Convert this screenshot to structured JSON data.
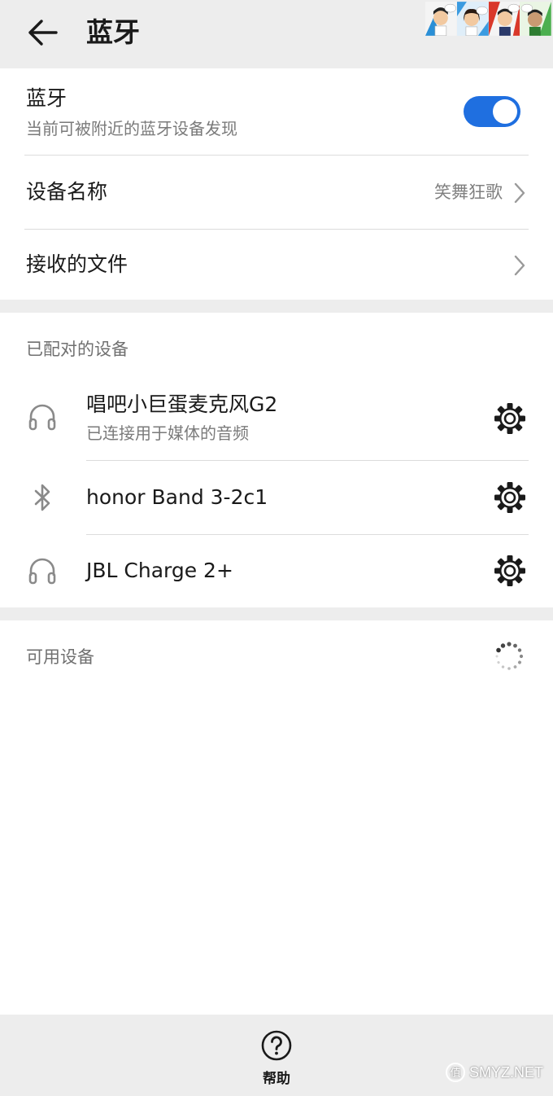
{
  "header": {
    "title": "蓝牙"
  },
  "bluetooth": {
    "label": "蓝牙",
    "subtitle": "当前可被附近的蓝牙设备发现",
    "enabled": true,
    "toggle_color": "#1f6fe0"
  },
  "device_name": {
    "label": "设备名称",
    "value": "笑舞狂歌"
  },
  "received_files": {
    "label": "接收的文件"
  },
  "paired": {
    "header": "已配对的设备",
    "devices": [
      {
        "name": "唱吧小巨蛋麦克风G2",
        "status": "已连接用于媒体的音频",
        "icon": "headphones-icon"
      },
      {
        "name": "honor Band 3-2c1",
        "status": "",
        "icon": "bluetooth-icon"
      },
      {
        "name": "JBL Charge 2+",
        "status": "",
        "icon": "headphones-icon"
      }
    ]
  },
  "available": {
    "header": "可用设备"
  },
  "footer": {
    "help_label": "帮助"
  },
  "watermark": {
    "text": "SMYZ.NET"
  }
}
